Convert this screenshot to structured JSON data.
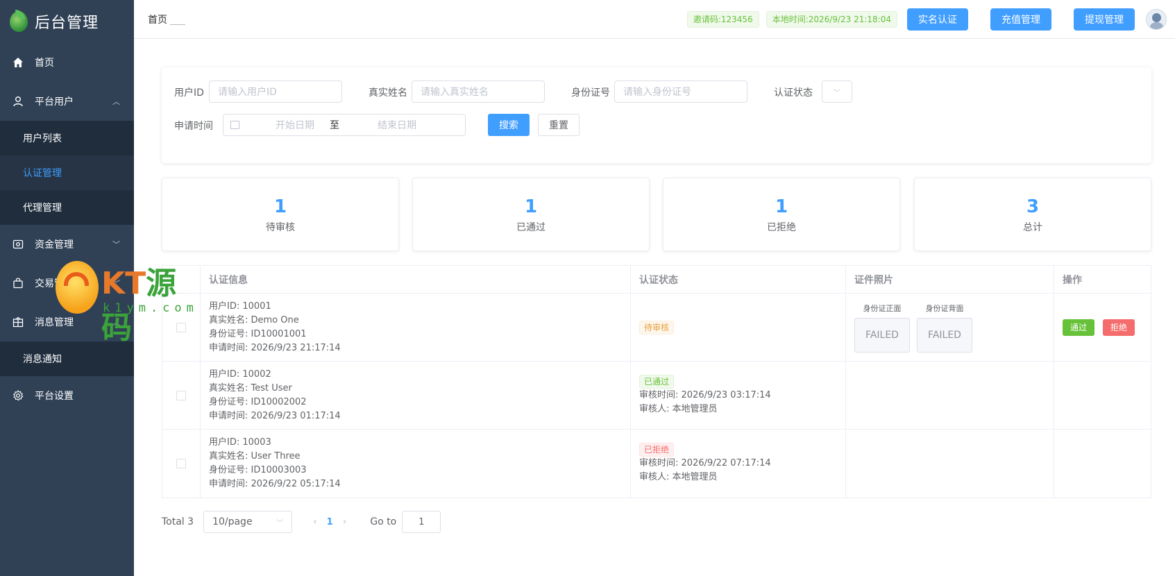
{
  "sidebar": {
    "logo_text": "后台管理",
    "items": [
      {
        "label": "首页"
      },
      {
        "label": "平台用户"
      },
      {
        "label": "资金管理"
      },
      {
        "label": "交易管理"
      },
      {
        "label": "消息管理"
      },
      {
        "label": "平台设置"
      }
    ],
    "sub_platform_users": [
      "用户列表",
      "认证管理",
      "代理管理"
    ],
    "sub_messages": [
      "消息通知"
    ]
  },
  "header": {
    "breadcrumb": "首页",
    "invite_code": "邀请码:123456",
    "local_time": "本地时间:2026/9/23 21:18:04",
    "btn_realname": "实名认证",
    "btn_recharge": "充值管理",
    "btn_withdraw": "提现管理"
  },
  "filter": {
    "user_id_label": "用户ID",
    "user_id_placeholder": "请输入用户ID",
    "real_name_label": "真实姓名",
    "real_name_placeholder": "请输入真实姓名",
    "id_card_label": "身份证号",
    "id_card_placeholder": "请输入身份证号",
    "status_label": "认证状态",
    "apply_time_label": "申请时间",
    "start_date": "开始日期",
    "to": "至",
    "end_date": "结束日期",
    "search_btn": "搜索",
    "reset_btn": "重置"
  },
  "stats": [
    {
      "value": "1",
      "label": "待审核"
    },
    {
      "value": "1",
      "label": "已通过"
    },
    {
      "value": "1",
      "label": "已拒绝"
    },
    {
      "value": "3",
      "label": "总计"
    }
  ],
  "table": {
    "columns": [
      "认证信息",
      "认证状态",
      "证件照片",
      "操作"
    ],
    "rows": [
      {
        "user_id": "用户ID: 10001",
        "real_name": "真实姓名: Demo One",
        "id_card": "身份证号: ID10001001",
        "apply_time": "申请时间: 2026/9/23 21:17:14",
        "status": "待审核",
        "front_caption": "身份证正面",
        "back_caption": "身份证背面",
        "front_img": "FAILED",
        "back_img": "FAILED",
        "op_pass": "通过",
        "op_reject": "拒绝"
      },
      {
        "user_id": "用户ID: 10002",
        "real_name": "真实姓名: Test User",
        "id_card": "身份证号: ID10002002",
        "apply_time": "申请时间: 2026/9/23 01:17:14",
        "status": "已通过",
        "review_time": "审核时间: 2026/9/23 03:17:14",
        "reviewer": "审核人: 本地管理员"
      },
      {
        "user_id": "用户ID: 10003",
        "real_name": "真实姓名: User Three",
        "id_card": "身份证号: ID10003003",
        "apply_time": "申请时间: 2026/9/22 05:17:14",
        "status": "已拒绝",
        "review_time": "审核时间: 2026/9/22 07:17:14",
        "reviewer": "审核人: 本地管理员"
      }
    ]
  },
  "pagination": {
    "total": "Total 3",
    "page_size": "10/page",
    "current": "1",
    "goto_label": "Go to",
    "goto_value": "1"
  },
  "watermark": {
    "text_kt": "KT",
    "text_src": "源码",
    "domain": "k1ym.com"
  },
  "colors": {
    "sidebar_bg": "#304156",
    "primary": "#409eff",
    "success": "#67c23a",
    "danger": "#f56c6c",
    "warning": "#e6a23c"
  }
}
